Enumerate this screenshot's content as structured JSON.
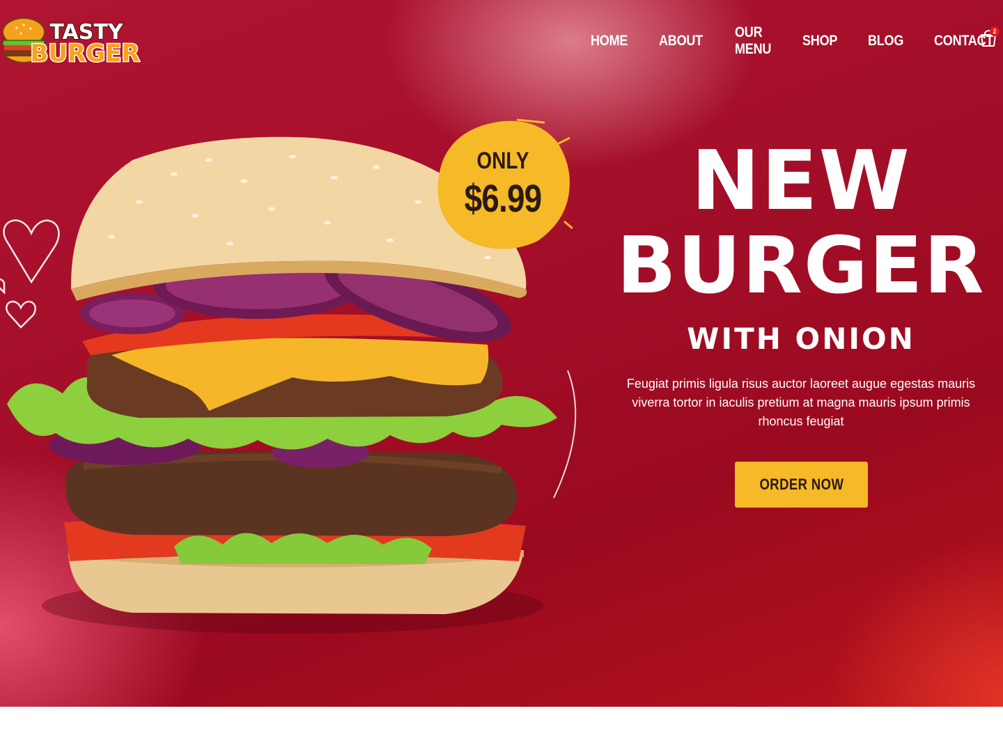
{
  "brand": {
    "logo_line1": "TASTY",
    "logo_line2": "BURGER"
  },
  "nav": {
    "items": [
      "HOME",
      "ABOUT",
      "OUR MENU",
      "SHOP",
      "BLOG",
      "CONTACT"
    ]
  },
  "cart": {
    "icon": "shopping-bag-icon",
    "count": "2"
  },
  "promo": {
    "only_label": "ONLY",
    "price": "$6.99"
  },
  "hero": {
    "title_line1": "NEW",
    "title_line2": "BURGER",
    "subtitle": "WITH ONION",
    "description": "Feugiat primis ligula risus auctor laoreet augue egestas mauris viverra tortor in iaculis pretium at magna mauris ipsum primis rhoncus feugiat",
    "cta_label": "ORDER NOW"
  },
  "colors": {
    "accent": "#f6b928",
    "hero_red": "#a20e28",
    "cart_badge": "#e21b1b",
    "text_dark": "#2a1a14"
  }
}
